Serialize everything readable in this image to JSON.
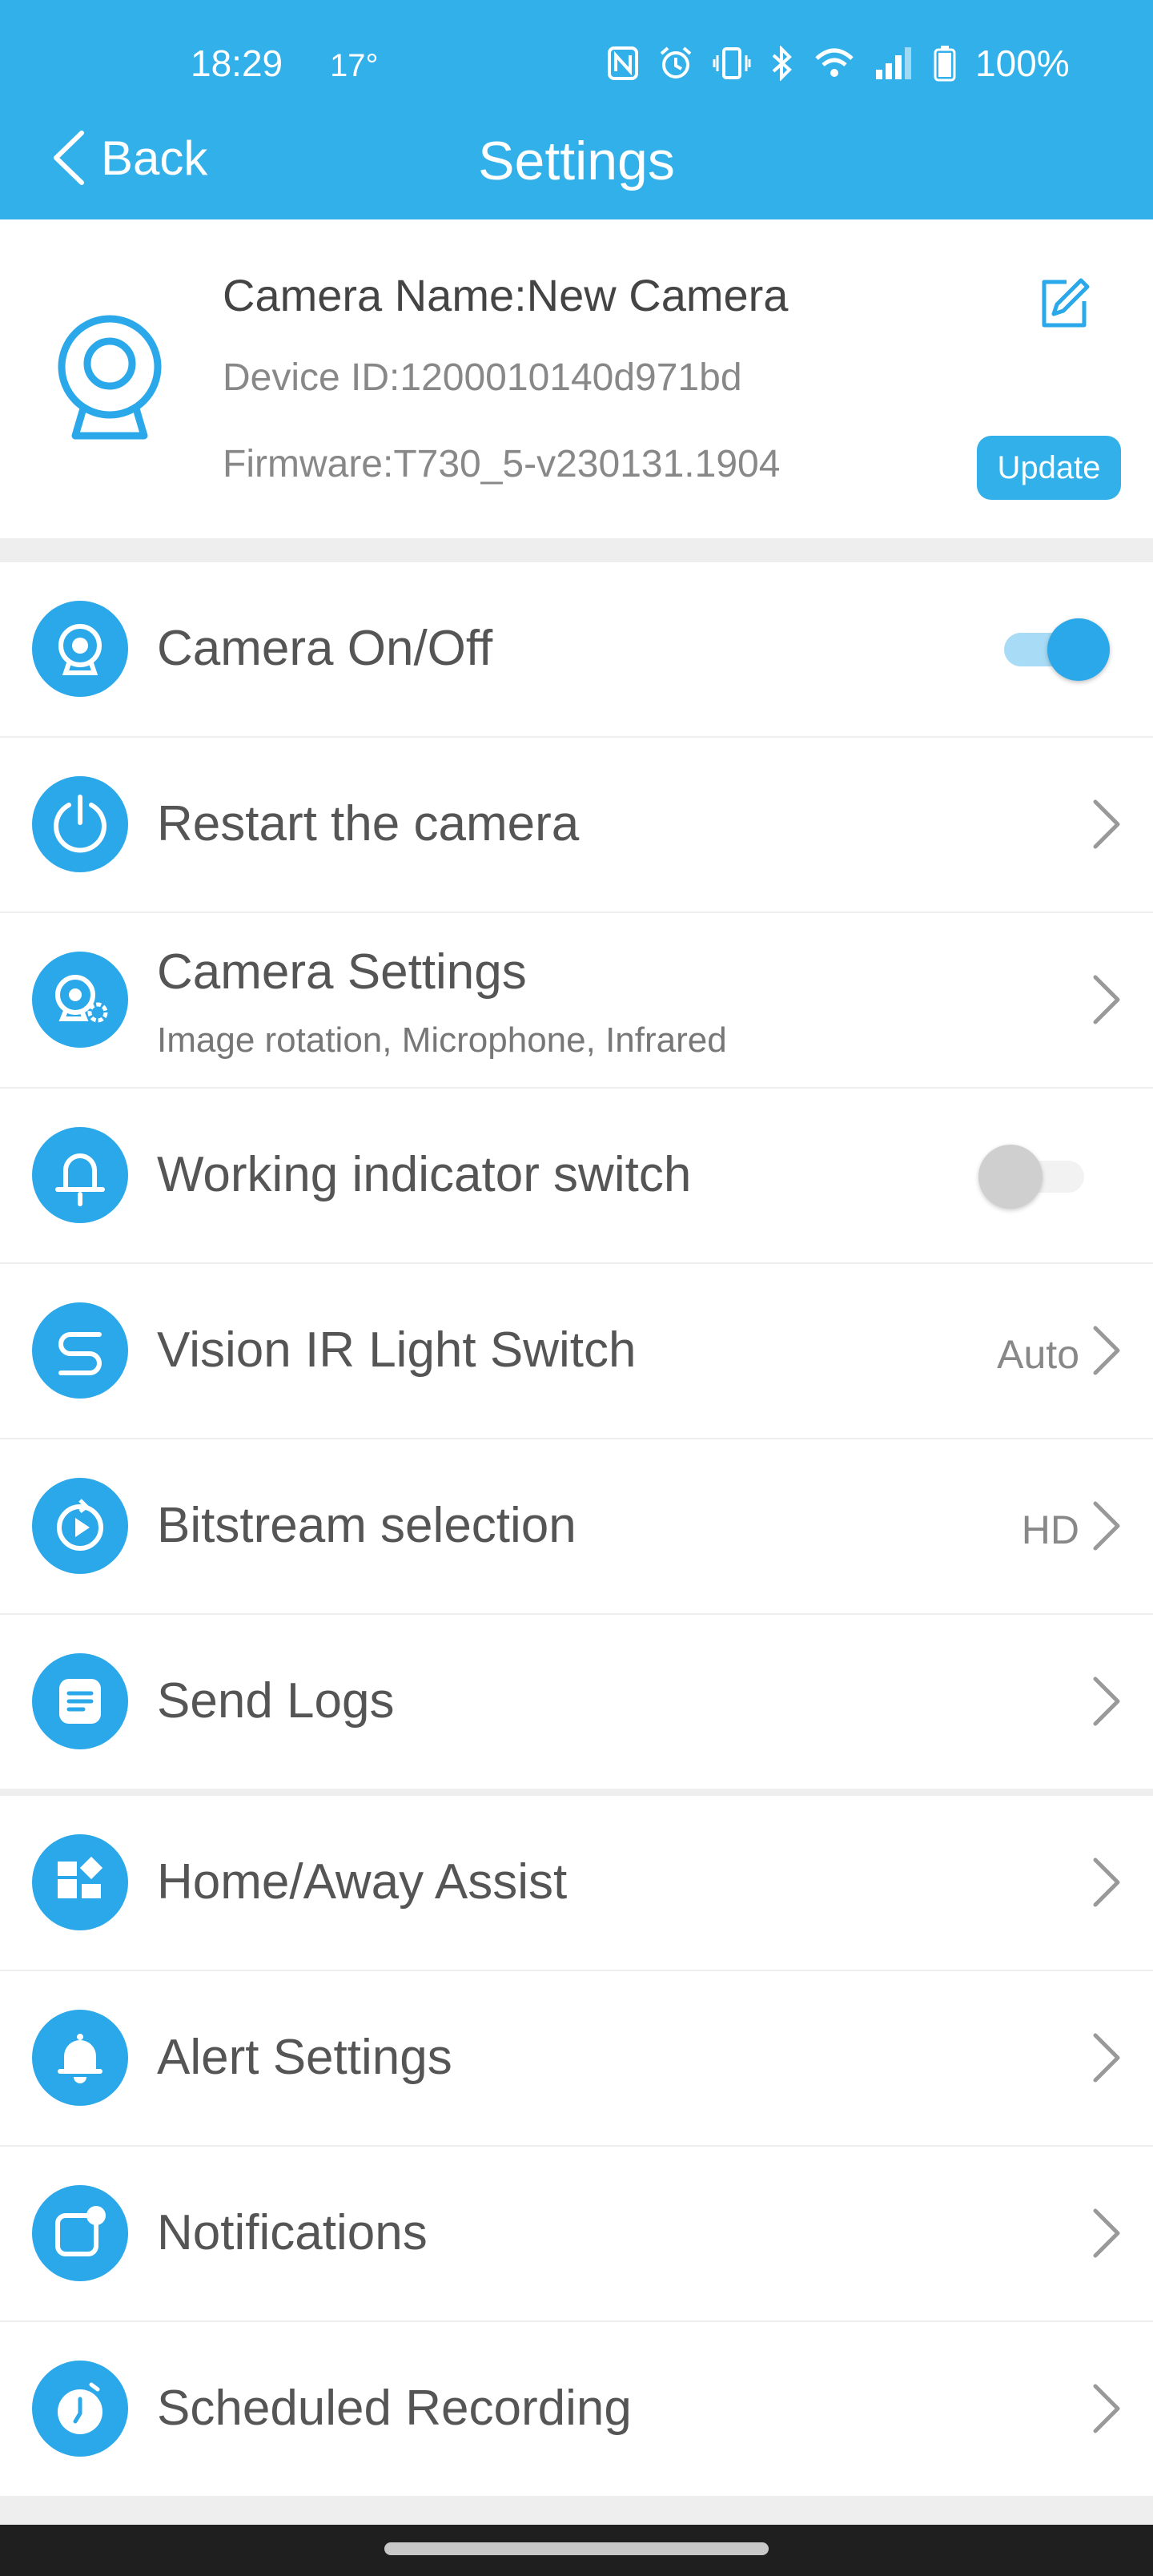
{
  "status_bar": {
    "time": "18:29",
    "extra": "17°",
    "battery": "100%",
    "icons": [
      "nfc-icon",
      "alarm-icon",
      "vibrate-icon",
      "bluetooth-icon",
      "wifi-icon",
      "signal-icon",
      "battery-icon"
    ]
  },
  "header": {
    "back_label": "Back",
    "title": "Settings",
    "color": "#31b0ea"
  },
  "device": {
    "name": "Camera Name:New Camera",
    "device_id": "Device ID:1200010140d971bd",
    "firmware": "Firmware:T730_5-v230131.1904",
    "update_label": "Update"
  },
  "group1": [
    {
      "label": "Camera On/Off",
      "icon": "camera-icon",
      "control": "toggle",
      "on": true
    },
    {
      "label": "Restart the camera",
      "icon": "power-icon",
      "control": "chevron"
    },
    {
      "label": "Camera Settings",
      "sublabel": "Image rotation, Microphone, Infrared",
      "icon": "camera-settings-icon",
      "control": "chevron"
    },
    {
      "label": "Working indicator switch",
      "icon": "indicator-light-icon",
      "control": "toggle",
      "on": false
    },
    {
      "label": "Vision IR Light Switch",
      "value": "Auto",
      "icon": "ir-light-icon",
      "control": "chevron"
    },
    {
      "label": "Bitstream selection",
      "value": "HD",
      "icon": "bitstream-icon",
      "control": "chevron"
    },
    {
      "label": "Send Logs",
      "icon": "logs-icon",
      "control": "chevron"
    }
  ],
  "group2": [
    {
      "label": "Home/Away Assist",
      "icon": "home-away-icon",
      "control": "chevron"
    },
    {
      "label": "Alert Settings",
      "icon": "bell-icon",
      "control": "chevron"
    },
    {
      "label": "Notifications",
      "icon": "notification-icon",
      "control": "chevron"
    },
    {
      "label": "Scheduled Recording",
      "icon": "clock-icon",
      "control": "chevron"
    }
  ]
}
